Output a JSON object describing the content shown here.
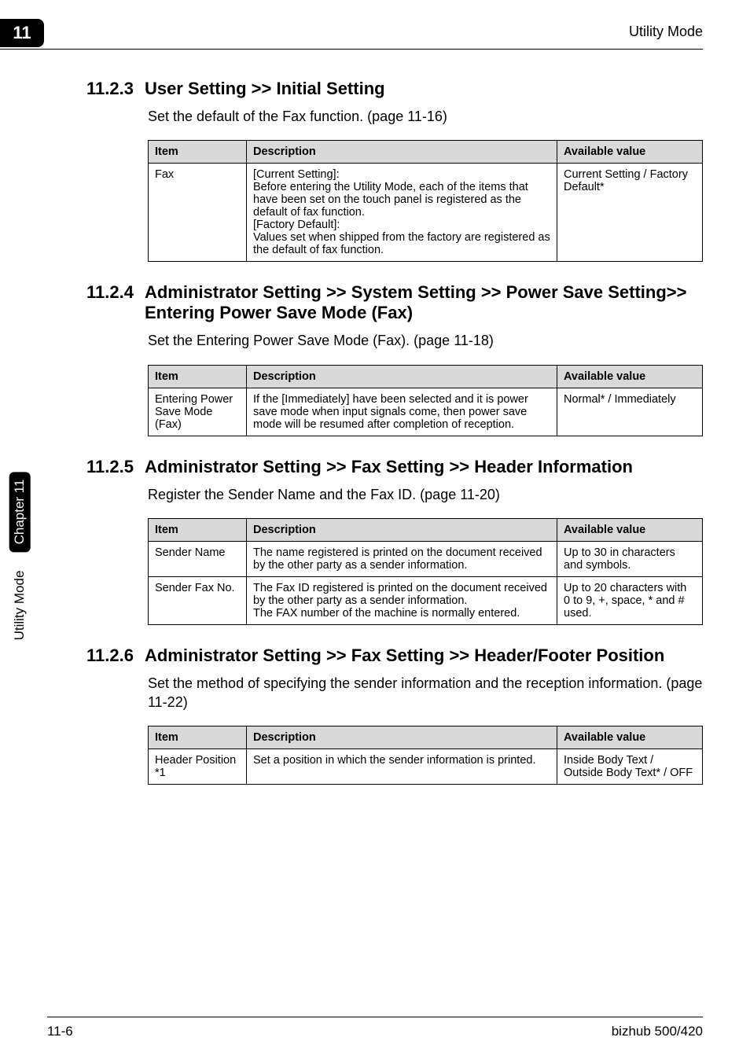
{
  "header": {
    "chapter_badge": "11",
    "right_label": "Utility Mode"
  },
  "side_tab": {
    "utility": "Utility Mode",
    "chapter": "Chapter 11"
  },
  "sections": [
    {
      "num": "11.2.3",
      "title": "User Setting >> Initial Setting",
      "intro": "Set the default of the Fax function. (page 11-16)",
      "table": {
        "head": {
          "c1": "Item",
          "c2": "Description",
          "c3": "Available value"
        },
        "rows": [
          {
            "c1": "Fax",
            "c2": "[Current Setting]:\nBefore entering the Utility Mode, each of the items that have been set on the touch panel is registered as the default of fax function.\n[Factory Default]:\nValues set when shipped from the factory are registered as the default of fax function.",
            "c3": "Current Setting / Factory Default*"
          }
        ]
      }
    },
    {
      "num": "11.2.4",
      "title": "Administrator Setting >> System Setting >> Power Save Setting>> Entering Power Save Mode (Fax)",
      "intro": "Set the Entering Power Save Mode (Fax). (page 11-18)",
      "table": {
        "head": {
          "c1": "Item",
          "c2": "Description",
          "c3": "Available value"
        },
        "rows": [
          {
            "c1": "Entering Power Save Mode (Fax)",
            "c2": "If the [Immediately] have been selected and it is power save mode when input signals come, then power save mode will be resumed after completion of reception.",
            "c3": "Normal* / Immediately"
          }
        ]
      }
    },
    {
      "num": "11.2.5",
      "title": "Administrator Setting >> Fax Setting >> Header Information",
      "intro": "Register the Sender Name and the Fax ID. (page 11-20)",
      "table": {
        "head": {
          "c1": "Item",
          "c2": "Description",
          "c3": "Available value"
        },
        "rows": [
          {
            "c1": "Sender Name",
            "c2": "The name registered is printed on the document received by the other party as a sender information.",
            "c3": "Up to 30 in characters and symbols."
          },
          {
            "c1": "Sender Fax No.",
            "c2": "The Fax ID registered is printed on the document received by the other party as a sender information.\nThe FAX number of the machine is normally entered.",
            "c3": "Up to 20 characters with 0 to 9, +, space, * and # used."
          }
        ]
      }
    },
    {
      "num": "11.2.6",
      "title": "Administrator Setting >> Fax Setting >> Header/Footer Position",
      "intro": "Set the method of specifying the sender information and the reception information. (page 11-22)",
      "table": {
        "head": {
          "c1": "Item",
          "c2": "Description",
          "c3": "Available value"
        },
        "rows": [
          {
            "c1": "Header Position *1",
            "c2": "Set a position in which the sender information is printed.",
            "c3": "Inside Body Text / Outside Body Text* / OFF"
          }
        ]
      }
    }
  ],
  "footer": {
    "page": "11-6",
    "model": "bizhub 500/420"
  }
}
